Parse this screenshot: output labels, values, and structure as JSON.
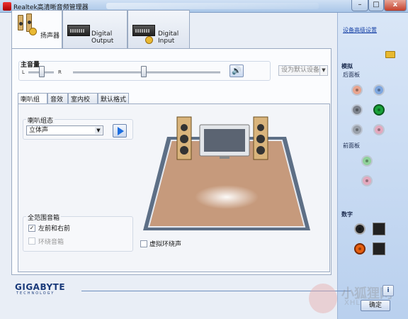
{
  "window": {
    "title": "Realtek高清晰音频管理器",
    "buttons": {
      "min": "–",
      "max": "□",
      "close": "x"
    }
  },
  "device_tabs": [
    {
      "label": "扬声器"
    },
    {
      "label": "Digital Output"
    },
    {
      "label": "Digital Input"
    }
  ],
  "volume": {
    "label": "主音量",
    "left": "L",
    "right": "R",
    "default_device": "设为默认设备"
  },
  "inner_tabs": [
    {
      "label": "喇叭组态"
    },
    {
      "label": "音效"
    },
    {
      "label": "室内校正"
    },
    {
      "label": "默认格式"
    }
  ],
  "speaker_config": {
    "label": "喇叭组态",
    "value": "立体声"
  },
  "full_range": {
    "label": "全范围音箱",
    "items": [
      {
        "label": "左前和右前",
        "checked": true,
        "enabled": true
      },
      {
        "label": "环绕音箱",
        "checked": false,
        "enabled": false
      }
    ]
  },
  "virtual_surround": {
    "label": "虚拟环绕声",
    "checked": false
  },
  "right_panel": {
    "advanced_link": "设备高级设置",
    "analog": "模拟",
    "back_panel": "后面板",
    "front_panel": "前面板",
    "digital": "数字",
    "jack_colors": [
      "#e8a48e",
      "#7ea6de",
      "#b9bec8",
      "#1aa23a",
      "#c9ccd4",
      "#e2a9be",
      "#8fd19a",
      "#e2a9be"
    ]
  },
  "footer": {
    "brand": "GIGABYTE",
    "brand_sub": "TECHNOLOGY",
    "info": "i",
    "ok": "确定"
  },
  "watermark": {
    "text": "小狐狸网",
    "sub": "XHLKS.CN"
  }
}
